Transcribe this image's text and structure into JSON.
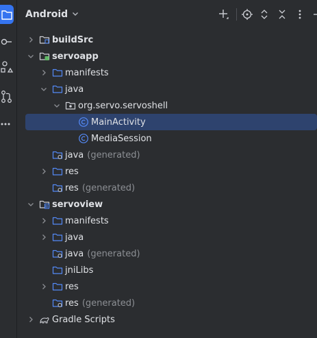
{
  "header": {
    "title": "Android",
    "icons": [
      "add-icon",
      "locate-icon",
      "expand-all-icon",
      "collapse-all-icon",
      "more-options-icon"
    ]
  },
  "rail": {
    "icons": [
      "project-icon",
      "commit-icon",
      "structure-icon",
      "pull-requests-icon",
      "more-icon"
    ]
  },
  "tree": [
    {
      "label": "buildSrc",
      "suffix": "",
      "bold": true,
      "icon": "module-folder-icon",
      "expandable": true,
      "expanded": false
    },
    {
      "label": "servoapp",
      "suffix": "",
      "bold": true,
      "icon": "app-module-icon",
      "expandable": true,
      "expanded": true
    },
    {
      "label": "manifests",
      "suffix": "",
      "bold": false,
      "icon": "folder-icon",
      "expandable": true,
      "expanded": false
    },
    {
      "label": "java",
      "suffix": "",
      "bold": false,
      "icon": "folder-icon",
      "expandable": true,
      "expanded": true
    },
    {
      "label": "org.servo.servoshell",
      "suffix": "",
      "bold": false,
      "icon": "package-icon",
      "expandable": true,
      "expanded": true
    },
    {
      "label": "MainActivity",
      "suffix": "",
      "bold": false,
      "icon": "class-icon",
      "expandable": false,
      "selected": true
    },
    {
      "label": "MediaSession",
      "suffix": "",
      "bold": false,
      "icon": "class-icon",
      "expandable": false
    },
    {
      "label": "java",
      "suffix": "(generated)",
      "bold": false,
      "icon": "generated-folder-icon",
      "expandable": false
    },
    {
      "label": "res",
      "suffix": "",
      "bold": false,
      "icon": "folder-icon",
      "expandable": true,
      "expanded": false
    },
    {
      "label": "res",
      "suffix": "(generated)",
      "bold": false,
      "icon": "generated-folder-icon",
      "expandable": false
    },
    {
      "label": "servoview",
      "suffix": "",
      "bold": true,
      "icon": "library-module-icon",
      "expandable": true,
      "expanded": true
    },
    {
      "label": "manifests",
      "suffix": "",
      "bold": false,
      "icon": "folder-icon",
      "expandable": true,
      "expanded": false
    },
    {
      "label": "java",
      "suffix": "",
      "bold": false,
      "icon": "folder-icon",
      "expandable": true,
      "expanded": false
    },
    {
      "label": "java",
      "suffix": "(generated)",
      "bold": false,
      "icon": "generated-folder-icon",
      "expandable": false
    },
    {
      "label": "jniLibs",
      "suffix": "",
      "bold": false,
      "icon": "folder-icon",
      "expandable": false
    },
    {
      "label": "res",
      "suffix": "",
      "bold": false,
      "icon": "folder-icon",
      "expandable": true,
      "expanded": false
    },
    {
      "label": "res",
      "suffix": "(generated)",
      "bold": false,
      "icon": "generated-folder-icon",
      "expandable": false
    },
    {
      "label": "Gradle Scripts",
      "suffix": "",
      "bold": false,
      "icon": "gradle-icon",
      "expandable": true,
      "expanded": false
    }
  ],
  "colors": {
    "background": "#2b2d30",
    "selection": "#2e436e",
    "accent": "#3574f0",
    "folder": "#548af7",
    "text": "#dfe1e5",
    "muted": "#8c8f94"
  }
}
